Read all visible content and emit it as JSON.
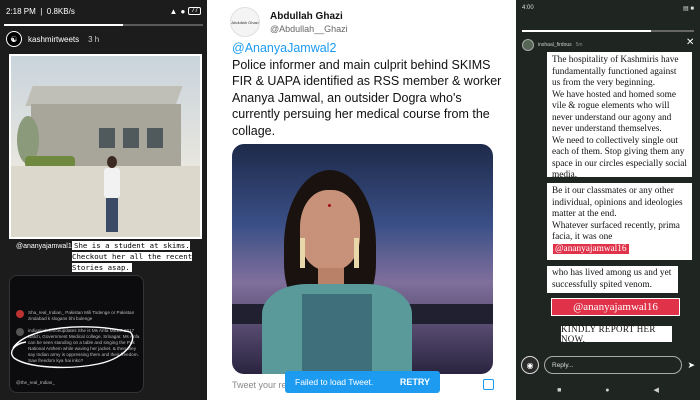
{
  "left": {
    "status": {
      "time": "2:18 PM",
      "speed": "0.8KB/s",
      "battery": "77"
    },
    "story_progress": 0.6,
    "account": "kashmirtweets",
    "time_ago": "3 h",
    "photo_handle": "@ananyajamwal16",
    "caption": "She is a student at skims. Checkout her all the recent Stories asap.",
    "embed": {
      "post1": "Sha_real_Indian_ Pakistan Mili Todenge or Pakistan zindabad k slogans bhi bulenge",
      "post2": "indianindefenceupdates She is Ms Anfa MBBS 2017 Batch, Government Medical college, Srinagar. Ms Anfa can be seen standing on a table and singing the Pak National Anthem while waving her jacket. & then they say Indian army is oppressing them and their freedom. Saw freedom kya hai inko?",
      "post3": "@the_real_Indian_"
    }
  },
  "tweet": {
    "author_name": "Abdullah Ghazi",
    "author_handle": "@Abdullah__Ghazi",
    "avatar_text": "Abdullah Ghazi",
    "mention": "@AnanyaJamwal2",
    "text": "Police informer and main culprit behind SKIMS FIR & UAPA identified as RSS member & worker Ananya Jamwal, an outsider Dogra who's currently persuing her medical course from the collage.",
    "reply_placeholder": "Tweet your reply",
    "toast_message": "Failed to load Tweet.",
    "toast_action": "RETRY"
  },
  "right": {
    "status": {
      "time": "4:00",
      "icons": "▤ ■"
    },
    "story_progress": 0.75,
    "account": "inshaal_firdous",
    "time_ago": "5m",
    "card1": [
      "The hospitality of Kashmiris have fundamentally functioned against us from the very beginning.",
      "We have hosted and homed some vile & rogue elements who will never understand our agony and never understand themselves.",
      "We need to collectively single out each of them. Stop giving them any space in our circles especially social media."
    ],
    "card2": [
      "Be it our classmates or any other individual, opinions and ideologies matter at the end.",
      "Whatever surfaced recently, prima facia, it was one"
    ],
    "inline_mention": "@ananyajamwal16",
    "card3": "who has lived among us and yet successfully spited venom.",
    "big_mention": "@ananyajamwal16",
    "report": "KINDLY REPORT HER NOW.",
    "reply_placeholder": "Reply..."
  },
  "icons": {
    "signal": "signal-icon",
    "wifi": "wifi-icon",
    "battery": "battery-icon",
    "camera": "camera-icon",
    "send": "send-icon",
    "close": "close-icon"
  },
  "colors": {
    "twitter_blue": "#1d9bf0",
    "mention_red": "#e0334a"
  }
}
